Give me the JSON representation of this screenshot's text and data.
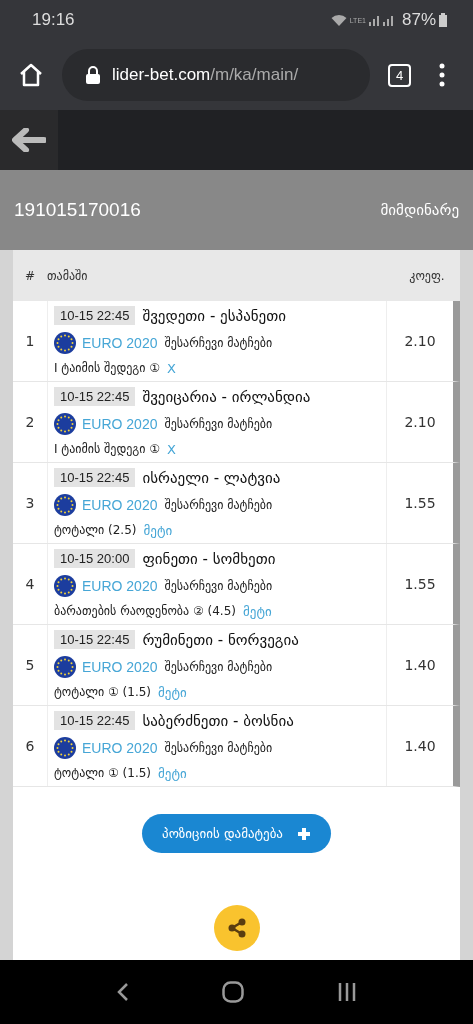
{
  "status_bar": {
    "time": "19:16",
    "network": "LTE1",
    "battery": "87%"
  },
  "browser": {
    "url_domain": "lider-bet.com",
    "url_path": "/m/ka/main/",
    "tab_count": "4"
  },
  "ticket": {
    "number": "191015170016",
    "status": "მიმდინარე"
  },
  "table": {
    "columns": [
      "#",
      "თამაში",
      "კოეფ."
    ],
    "rows": [
      {
        "index": "1",
        "time": "10-15 22:45",
        "match": "შვედეთი - ესპანეთი",
        "league": "EURO 2020",
        "stage": "შესარჩევი მატჩები",
        "bet": [
          {
            "kind": "market",
            "text": "I ტაიმის შედეგი ①"
          },
          {
            "kind": "pick",
            "text": "X"
          }
        ],
        "odds": "2.10"
      },
      {
        "index": "2",
        "time": "10-15 22:45",
        "match": "შვეიცარია - ირლანდია",
        "league": "EURO 2020",
        "stage": "შესარჩევი მატჩები",
        "bet": [
          {
            "kind": "market",
            "text": "I ტაიმის შედეგი ①"
          },
          {
            "kind": "pick",
            "text": "X"
          }
        ],
        "odds": "2.10"
      },
      {
        "index": "3",
        "time": "10-15 22:45",
        "match": "ისრაელი - ლატვია",
        "league": "EURO 2020",
        "stage": "შესარჩევი მატჩები",
        "bet": [
          {
            "kind": "market",
            "text": "ტოტალი (2.5)"
          },
          {
            "kind": "pick",
            "text": "მეტი"
          }
        ],
        "odds": "1.55"
      },
      {
        "index": "4",
        "time": "10-15 20:00",
        "match": "ფინეთი - სომხეთი",
        "league": "EURO 2020",
        "stage": "შესარჩევი მატჩები",
        "bet": [
          {
            "kind": "market",
            "text": "ბარათების რაოდენობა ② (4.5)"
          },
          {
            "kind": "pick",
            "text": "მეტი"
          }
        ],
        "odds": "1.55"
      },
      {
        "index": "5",
        "time": "10-15 22:45",
        "match": "რუმინეთი - ნორვეგია",
        "league": "EURO 2020",
        "stage": "შესარჩევი მატჩები",
        "bet": [
          {
            "kind": "market",
            "text": "ტოტალი ① (1.5)"
          },
          {
            "kind": "pick",
            "text": "მეტი"
          }
        ],
        "odds": "1.40"
      },
      {
        "index": "6",
        "time": "10-15 22:45",
        "match": "საბერძნეთი - ბოსნია",
        "league": "EURO 2020",
        "stage": "შესარჩევი მატჩები",
        "bet": [
          {
            "kind": "market",
            "text": "ტოტალი ① (1.5)"
          },
          {
            "kind": "pick",
            "text": "მეტი"
          }
        ],
        "odds": "1.40"
      }
    ]
  },
  "add_button": {
    "label": "პოზიციის დამატება"
  }
}
